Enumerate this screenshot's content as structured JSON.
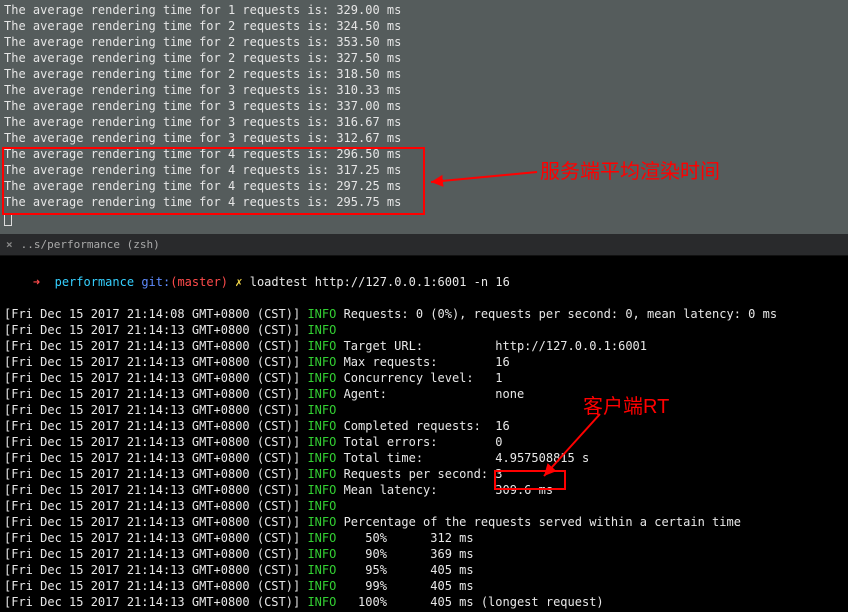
{
  "top_pane": {
    "lines": [
      {
        "n": 1,
        "ms": "329.00"
      },
      {
        "n": 2,
        "ms": "324.50"
      },
      {
        "n": 2,
        "ms": "353.50"
      },
      {
        "n": 2,
        "ms": "327.50"
      },
      {
        "n": 2,
        "ms": "318.50"
      },
      {
        "n": 3,
        "ms": "310.33"
      },
      {
        "n": 3,
        "ms": "337.00"
      },
      {
        "n": 3,
        "ms": "316.67"
      },
      {
        "n": 3,
        "ms": "312.67"
      },
      {
        "n": 4,
        "ms": "296.50"
      },
      {
        "n": 4,
        "ms": "317.25"
      },
      {
        "n": 4,
        "ms": "297.25"
      },
      {
        "n": 4,
        "ms": "295.75"
      }
    ],
    "prefix": "The average rendering time for ",
    "mid": " requests is: ",
    "suffix": " ms"
  },
  "annotations": {
    "server_render": "服务端平均渲染时间",
    "client_rt": "客户端RT"
  },
  "tab": {
    "title": "..s/performance (zsh)"
  },
  "prompt": {
    "arrow": "➜",
    "path": "performance",
    "git_label": "git:",
    "branch": "(master)",
    "lightning": "✗",
    "command": "loadtest http://127.0.0.1:6001 -n 16"
  },
  "loadtest": {
    "ts1": "[Fri Dec 15 2017 21:14:08 GMT+0800 (CST)]",
    "ts2": "[Fri Dec 15 2017 21:14:13 GMT+0800 (CST)]",
    "info": "INFO",
    "first_line_rest": " Requests: 0 (0%), requests per second: 0, mean latency: 0 ms",
    "rows": [
      {
        "k": "Target URL:",
        "v": "http://127.0.0.1:6001"
      },
      {
        "k": "Max requests:",
        "v": "16"
      },
      {
        "k": "Concurrency level:",
        "v": "1"
      },
      {
        "k": "Agent:",
        "v": "none"
      }
    ],
    "rows2": [
      {
        "k": "Completed requests:",
        "v": "16"
      },
      {
        "k": "Total errors:",
        "v": "0"
      },
      {
        "k": "Total time:",
        "v": "4.957508815 s"
      },
      {
        "k": "Requests per second:",
        "v": "3"
      },
      {
        "k": "Mean latency:",
        "v": "309.6 ms"
      }
    ],
    "pct_header": "Percentage of the requests served within a certain time",
    "pcts": [
      {
        "p": "50%",
        "v": "312 ms"
      },
      {
        "p": "90%",
        "v": "369 ms"
      },
      {
        "p": "95%",
        "v": "405 ms"
      },
      {
        "p": "99%",
        "v": "405 ms"
      },
      {
        "p": "100%",
        "v": "405 ms (longest request)"
      }
    ]
  }
}
